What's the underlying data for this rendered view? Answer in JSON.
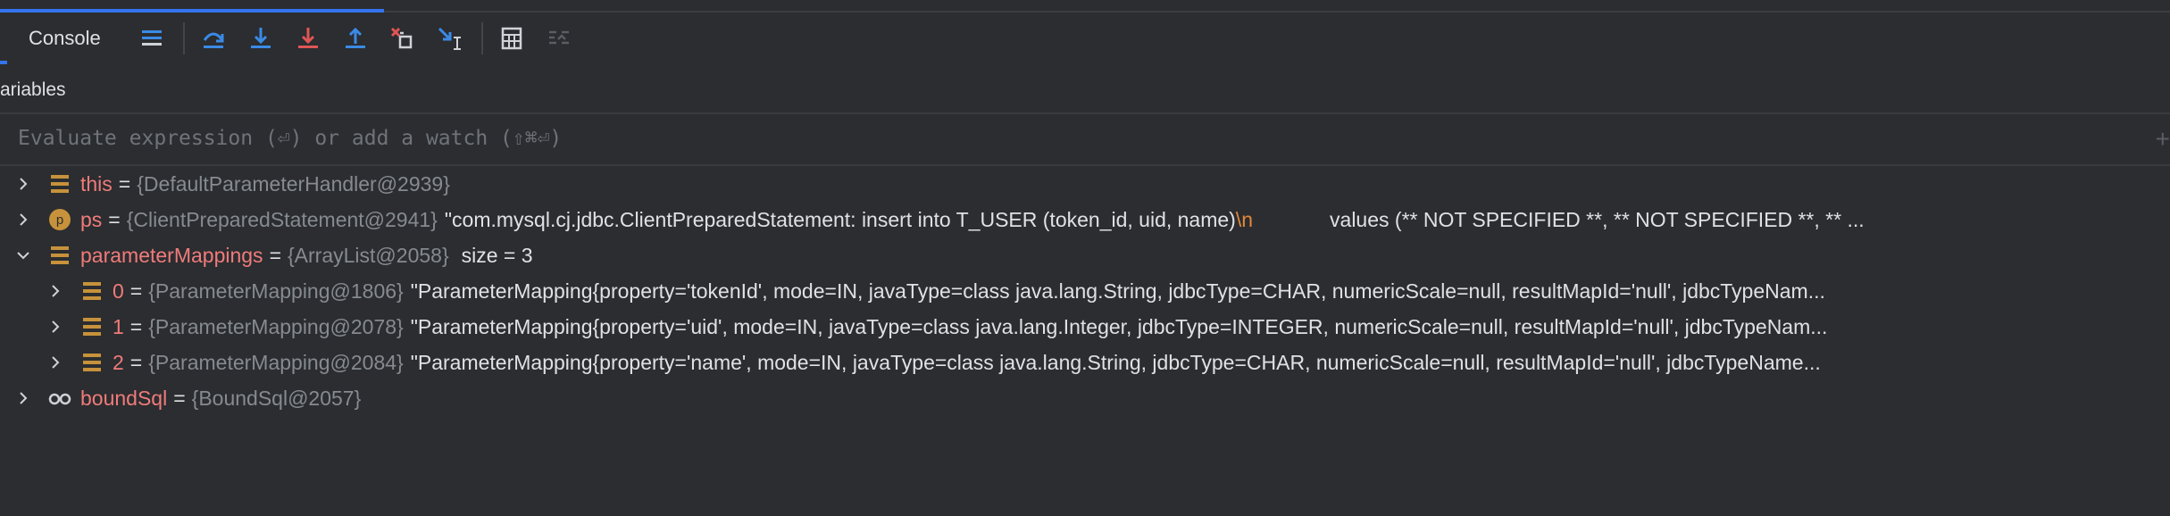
{
  "toolbar": {
    "console_tab": "Console",
    "icons": [
      "threads-list-icon",
      "step-over-icon",
      "step-into-icon",
      "force-step-into-icon",
      "step-out-icon",
      "drop-frame-icon",
      "run-to-cursor-icon",
      "evaluate-expression-icon",
      "trace-icon"
    ]
  },
  "variables": {
    "header": "ariables",
    "eval_placeholder": "Evaluate expression (⏎) or add a watch (⇧⌘⏎)",
    "add_glyph": "+",
    "rows": [
      {
        "name": "this",
        "eq": "=",
        "type": "{DefaultParameterHandler@2939}"
      },
      {
        "name": "ps",
        "eq": "=",
        "type": "{ClientPreparedStatement@2941}",
        "value_a": "\"com.mysql.cj.jdbc.ClientPreparedStatement: insert into T_USER (token_id, uid, name)",
        "escape": "\\n",
        "value_b": "values (** NOT SPECIFIED **, ** NOT SPECIFIED **, ** ..."
      },
      {
        "name": "parameterMappings",
        "eq": "=",
        "type": "{ArrayList@2058}",
        "meta": "size = 3"
      },
      {
        "name": "0",
        "eq": "=",
        "type": "{ParameterMapping@1806}",
        "value": "\"ParameterMapping{property='tokenId', mode=IN, javaType=class java.lang.String, jdbcType=CHAR, numericScale=null, resultMapId='null', jdbcTypeNam..."
      },
      {
        "name": "1",
        "eq": "=",
        "type": "{ParameterMapping@2078}",
        "value": "\"ParameterMapping{property='uid', mode=IN, javaType=class java.lang.Integer, jdbcType=INTEGER, numericScale=null, resultMapId='null', jdbcTypeNam..."
      },
      {
        "name": "2",
        "eq": "=",
        "type": "{ParameterMapping@2084}",
        "value": "\"ParameterMapping{property='name', mode=IN, javaType=class java.lang.String, jdbcType=CHAR, numericScale=null, resultMapId='null', jdbcTypeName..."
      },
      {
        "name": "boundSql",
        "eq": "=",
        "type": "{BoundSql@2057}"
      }
    ]
  },
  "colors": {
    "accent": "#3574f0",
    "var_name": "#f07b7b",
    "escape": "#e3873b",
    "field_icon": "#c7923b"
  }
}
